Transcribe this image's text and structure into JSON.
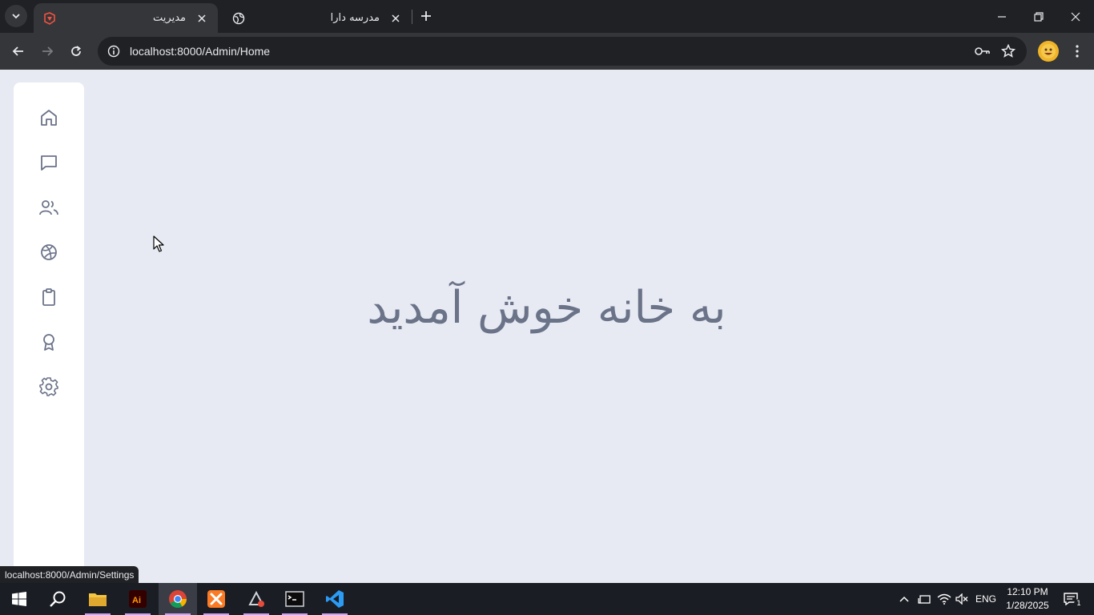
{
  "browser": {
    "tabs": [
      {
        "title": "مدیریت",
        "active": true,
        "favicon": "laravel-logo-icon"
      },
      {
        "title": "مدرسه دارا",
        "active": false,
        "favicon": "globe-icon"
      }
    ],
    "url": "localhost:8000/Admin/Home",
    "status_url": "localhost:8000/Admin/Settings"
  },
  "page": {
    "welcome_text": "به خانه خوش آمدید",
    "sidebar": {
      "items": [
        {
          "icon": "home-icon"
        },
        {
          "icon": "chat-icon"
        },
        {
          "icon": "users-icon"
        },
        {
          "icon": "basketball-icon"
        },
        {
          "icon": "clipboard-icon"
        },
        {
          "icon": "award-icon"
        },
        {
          "icon": "settings-gear-icon"
        }
      ]
    },
    "colors": {
      "background": "#e7eaf3",
      "sidebar": "#ffffff",
      "welcome_text": "#6b7389"
    }
  },
  "taskbar": {
    "apps": [
      "file-explorer-icon",
      "adobe-illustrator-icon",
      "chrome-icon",
      "xampp-icon",
      "app-icon",
      "terminal-icon",
      "vscode-icon"
    ],
    "language": "ENG",
    "time": "12:10 PM",
    "date": "1/28/2025",
    "notification_count": "1"
  }
}
